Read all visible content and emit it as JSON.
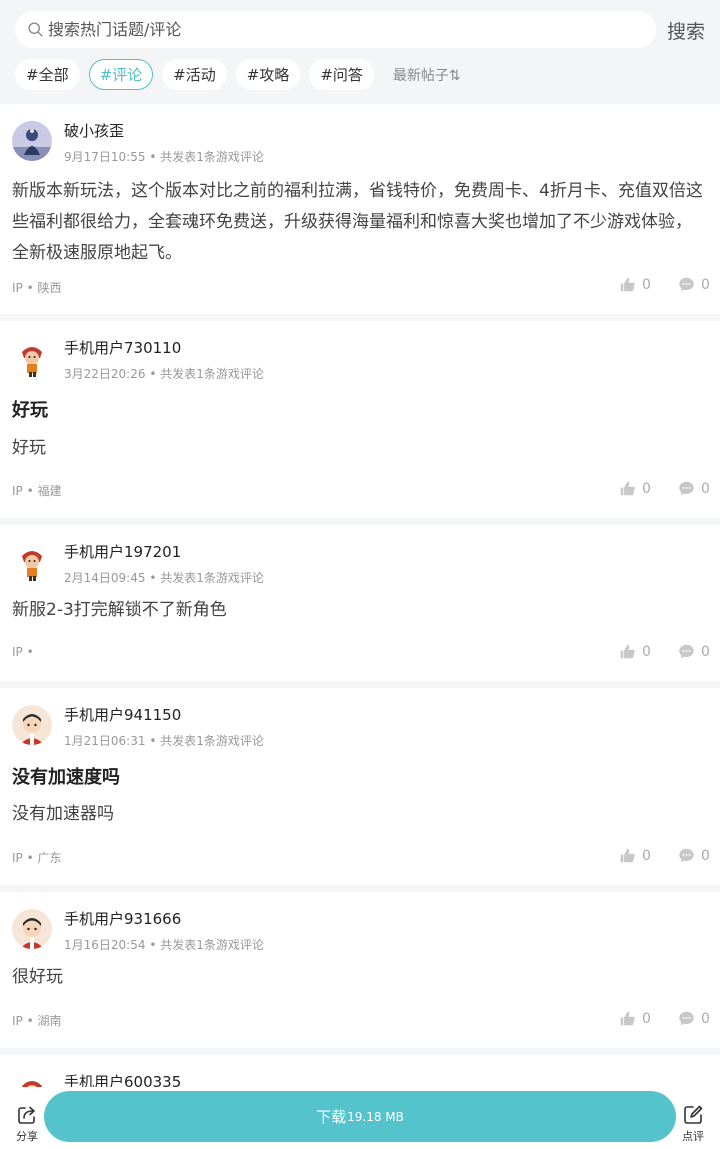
{
  "search": {
    "placeholder": "搜索热门话题/评论",
    "button_label": "搜索"
  },
  "tags": [
    "#全部",
    "#评论",
    "#活动",
    "#攻略",
    "#问答"
  ],
  "sort_label": "最新帖子⇅",
  "posts": [
    {
      "username": "破小孩歪",
      "date": "9月17日10:55",
      "meta_suffix": "共发表1条游戏评论",
      "title": "",
      "text": "新版本新玩法，这个版本对比之前的福利拉满，省钱特价，免费周卡、4折月卡、充值双倍这些福利都很给力，全套魂环免费送，升级获得海量福利和惊喜大奖也增加了不少游戏体验，全新极速服原地起飞。",
      "ip": "IP • 陕西",
      "likes": "0",
      "comments": "0"
    },
    {
      "username": "手机用户730110",
      "date": "3月22日20:26",
      "meta_suffix": "共发表1条游戏评论",
      "title": "好玩",
      "text": "好玩",
      "ip": "IP • 福建",
      "likes": "0",
      "comments": "0"
    },
    {
      "username": "手机用户197201",
      "date": "2月14日09:45",
      "meta_suffix": "共发表1条游戏评论",
      "title": "",
      "text": "新服2-3打完解锁不了新角色",
      "ip": "IP •",
      "likes": "0",
      "comments": "0"
    },
    {
      "username": "手机用户941150",
      "date": "1月21日06:31",
      "meta_suffix": "共发表1条游戏评论",
      "title": "没有加速度吗",
      "text": "没有加速器吗",
      "ip": "IP • 广东",
      "likes": "0",
      "comments": "0"
    },
    {
      "username": "手机用户931666",
      "date": "1月16日20:54",
      "meta_suffix": "共发表1条游戏评论",
      "title": "",
      "text": "很好玩",
      "ip": "IP • 湖南",
      "likes": "0",
      "comments": "0"
    },
    {
      "username": "手机用户600335"
    }
  ],
  "bottom": {
    "share_label": "分享",
    "download_label": "下载",
    "download_size": "19.18 MB",
    "comment_label": "点评"
  },
  "colors": {
    "accent": "#54c3cc",
    "tag_active": "#4fc1c7",
    "background": "#f4f5f7"
  },
  "icons": [
    "search-icon",
    "thumb-up-icon",
    "comment-bubble-icon",
    "share-icon",
    "edit-icon"
  ]
}
